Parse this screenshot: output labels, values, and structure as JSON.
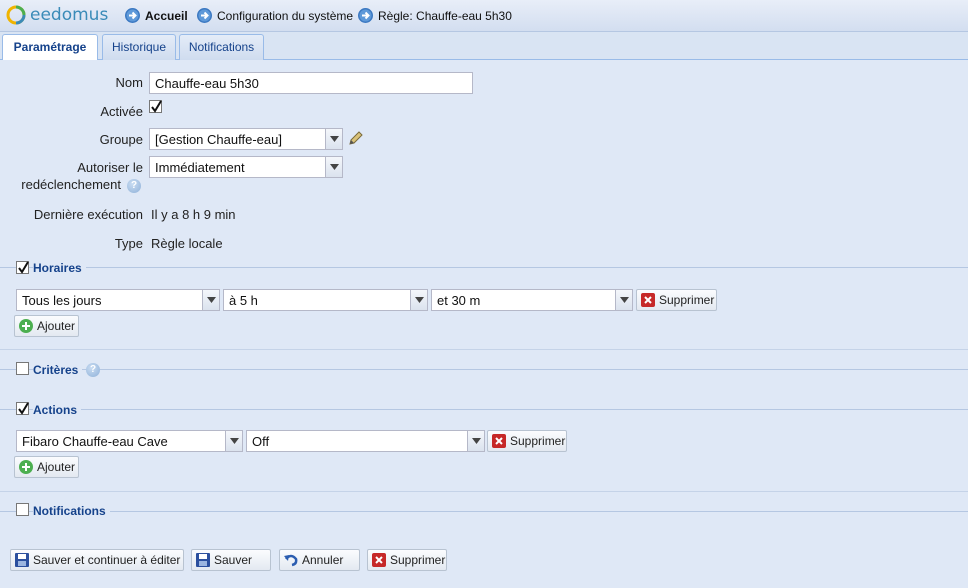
{
  "header": {
    "logo_text": "eedomus",
    "breadcrumbs": [
      {
        "label": "Accueil"
      },
      {
        "label": "Configuration du système"
      },
      {
        "label": "Règle: Chauffe-eau 5h30"
      }
    ]
  },
  "tabs": [
    {
      "label": "Paramétrage",
      "active": true
    },
    {
      "label": "Historique",
      "active": false
    },
    {
      "label": "Notifications",
      "active": false
    }
  ],
  "form": {
    "nom_label": "Nom",
    "nom_value": "Chauffe-eau 5h30",
    "activee_label": "Activée",
    "activee_checked": true,
    "groupe_label": "Groupe",
    "groupe_value": "[Gestion Chauffe-eau]",
    "autoriser_label_1": "Autoriser le",
    "autoriser_label_2": "redéclenchement",
    "autoriser_value": "Immédiatement",
    "derniere_label": "Dernière exécution",
    "derniere_value": "Il y a 8 h 9 min",
    "type_label": "Type",
    "type_value": "Règle locale"
  },
  "horaires": {
    "title": "Horaires",
    "checked": true,
    "row": {
      "frequence": "Tous les jours",
      "heure": "à 5 h",
      "minute": "et 30 m",
      "delete_label": "Supprimer"
    },
    "add_label": "Ajouter"
  },
  "criteres": {
    "title": "Critères",
    "checked": false
  },
  "actions": {
    "title": "Actions",
    "checked": true,
    "row": {
      "device": "Fibaro Chauffe-eau Cave",
      "value": "Off",
      "delete_label": "Supprimer"
    },
    "add_label": "Ajouter"
  },
  "notifications": {
    "title": "Notifications",
    "checked": false
  },
  "footer": {
    "save_continue_label": "Sauver et continuer à éditer",
    "save_label": "Sauver",
    "cancel_label": "Annuler",
    "delete_label": "Supprimer"
  },
  "colors": {
    "accent": "#15428b",
    "background": "#dfe8f6",
    "delete": "#c62828",
    "add": "#4caf50"
  }
}
